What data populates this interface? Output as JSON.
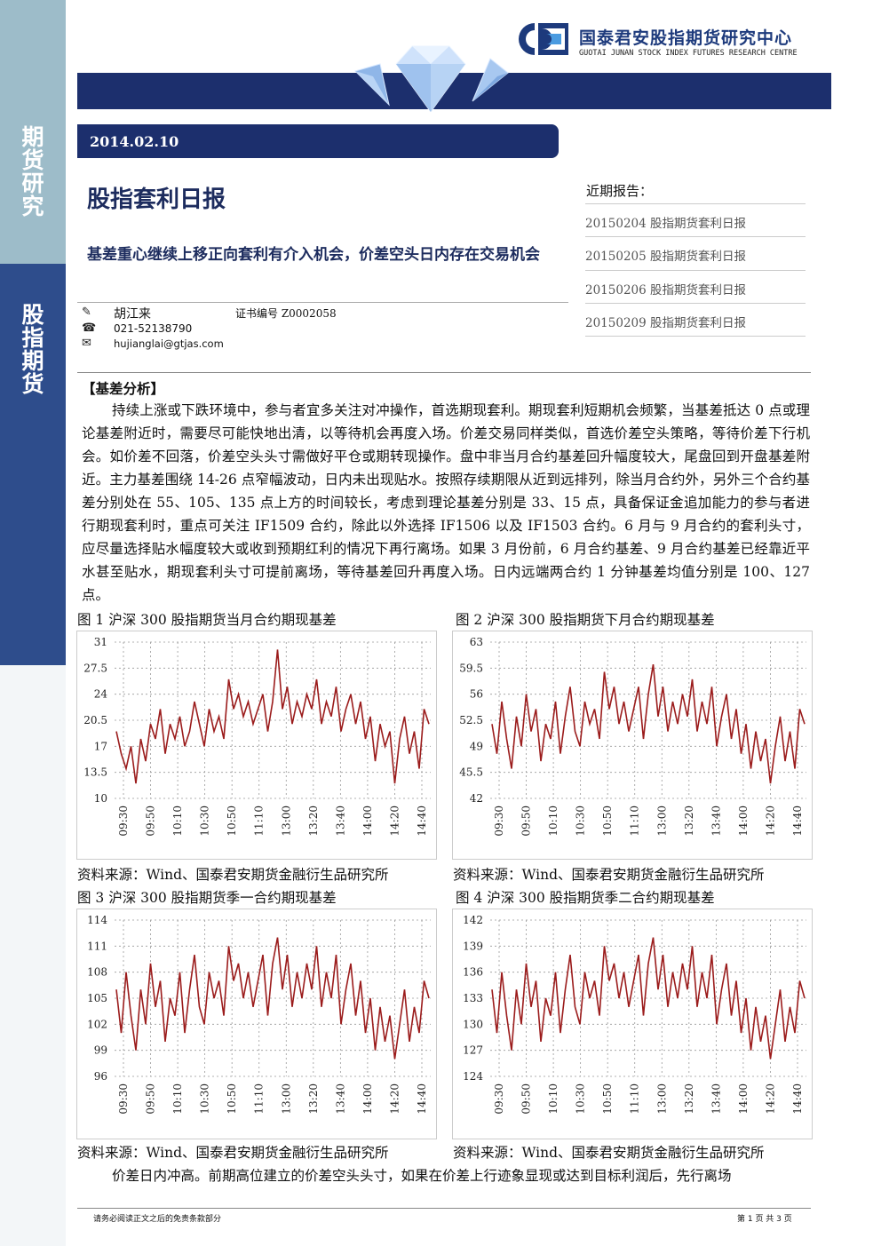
{
  "sidebar": {
    "top_label": "期货研究",
    "mid_label": "股指期货"
  },
  "header": {
    "org_cn": "国泰君安股指期货研究中心",
    "org_en": "GUOTAI JUNAN STOCK INDEX FUTURES RESEARCH CENTRE",
    "date": "2014.02.10",
    "brand_color": "#1c2f6d"
  },
  "report": {
    "title": "股指套利日报",
    "subtitle": "基差重心继续上移正向套利有介入机会，价差空头日内存在交易机会"
  },
  "author": {
    "name": "胡江来",
    "cert": "证书编号 Z0002058",
    "phone": "021-52138790",
    "email": "hujianglai@gtjas.com"
  },
  "recent": {
    "title": "近期报告：",
    "items": [
      "20150204 股指期货套利日报",
      "20150205 股指期货套利日报",
      "20150206 股指期货套利日报",
      "20150209 股指期货套利日报"
    ]
  },
  "section": {
    "label": "【基差分析】",
    "paragraph": "持续上涨或下跌环境中，参与者宜多关注对冲操作，首选期现套利。期现套利短期机会频繁，当基差抵达 0 点或理论基差附近时，需要尽可能快地出清，以等待机会再度入场。价差交易同样类似，首选价差空头策略，等待价差下行机会。如价差不回落，价差空头头寸需做好平仓或期转现操作。盘中非当月合约基差回升幅度较大，尾盘回到开盘基差附近。主力基差围绕 14-26 点窄幅波动，日内未出现贴水。按照存续期限从近到远排列，除当月合约外，另外三个合约基差分别处在 55、105、135 点上方的时间较长，考虑到理论基差分别是 33、15 点，具备保证金追加能力的参与者进行期现套利时，重点可关注 IF1509 合约，除此以外选择 IF1506 以及 IF1503 合约。6 月与 9 月合约的套利头寸，应尽量选择贴水幅度较大或收到预期红利的情况下再行离场。如果 3 月份前，6 月合约基差、9 月合约基差已经靠近平水甚至贴水，期现套利头寸可提前离场，等待基差回升再度入场。日内远端两合约 1 分钟基差均值分别是 100、127 点。",
    "paragraph2": "价差日内冲高。前期高位建立的价差空头头寸，如果在价差上行迹象显现或达到目标利润后，先行离场"
  },
  "figures": [
    {
      "title": "图 1 沪深 300 股指期货当月合约期现基差",
      "source": "资料来源：Wind、国泰君安期货金融衍生品研究所"
    },
    {
      "title": "图 2 沪深 300 股指期货下月合约期现基差",
      "source": "资料来源：Wind、国泰君安期货金融衍生品研究所"
    },
    {
      "title": "图 3 沪深 300 股指期货季一合约期现基差",
      "source": "资料来源：Wind、国泰君安期货金融衍生品研究所"
    },
    {
      "title": "图 4 沪深 300 股指期货季二合约期现基差",
      "source": "资料来源：Wind、国泰君安期货金融衍生品研究所"
    }
  ],
  "chart_data": [
    {
      "type": "line",
      "line_color": "#9b1c1c",
      "grid": true,
      "x_ticks": [
        "09:30",
        "09:50",
        "10:10",
        "10:30",
        "10:50",
        "11:10",
        "13:00",
        "13:20",
        "13:40",
        "14:00",
        "14:20",
        "14:40"
      ],
      "y_ticks": [
        "31",
        "27.5",
        "24",
        "20.5",
        "17",
        "13.5",
        "10"
      ],
      "ylim": [
        10,
        31
      ],
      "series": [
        {
          "values": [
            19,
            16,
            14,
            17,
            12,
            18,
            15,
            20,
            18,
            22,
            16,
            20,
            18,
            21,
            17,
            19,
            23,
            20,
            17,
            22,
            19,
            21,
            18,
            26,
            22,
            24,
            21,
            23,
            20,
            22,
            24,
            19,
            23,
            30,
            22,
            25,
            20,
            23,
            21,
            24,
            22,
            26,
            20,
            23,
            21,
            25,
            19,
            22,
            24,
            20,
            23,
            18,
            21,
            15,
            20,
            17,
            19,
            12,
            18,
            21,
            16,
            19,
            14,
            22,
            20
          ]
        }
      ]
    },
    {
      "type": "line",
      "line_color": "#9b1c1c",
      "grid": true,
      "x_ticks": [
        "09:30",
        "09:50",
        "10:10",
        "10:30",
        "10:50",
        "11:10",
        "13:00",
        "13:20",
        "13:40",
        "14:00",
        "14:20",
        "14:40"
      ],
      "y_ticks": [
        "63",
        "59.5",
        "56",
        "52.5",
        "49",
        "45.5",
        "42"
      ],
      "ylim": [
        42,
        63
      ],
      "series": [
        {
          "values": [
            52,
            48,
            55,
            50,
            46,
            53,
            49,
            56,
            51,
            54,
            47,
            52,
            50,
            55,
            48,
            53,
            57,
            51,
            49,
            55,
            52,
            54,
            50,
            59,
            54,
            57,
            52,
            55,
            51,
            54,
            57,
            50,
            56,
            60,
            53,
            57,
            51,
            55,
            52,
            56,
            53,
            58,
            51,
            55,
            52,
            57,
            49,
            53,
            56,
            50,
            54,
            48,
            52,
            46,
            51,
            47,
            50,
            44,
            49,
            53,
            47,
            51,
            46,
            54,
            52
          ]
        }
      ]
    },
    {
      "type": "line",
      "line_color": "#9b1c1c",
      "grid": true,
      "x_ticks": [
        "09:30",
        "09:50",
        "10:10",
        "10:30",
        "10:50",
        "11:10",
        "13:00",
        "13:20",
        "13:40",
        "14:00",
        "14:20",
        "14:40"
      ],
      "y_ticks": [
        "114",
        "111",
        "108",
        "105",
        "102",
        "99",
        "96"
      ],
      "ylim": [
        96,
        114
      ],
      "series": [
        {
          "values": [
            106,
            101,
            108,
            103,
            99,
            106,
            102,
            109,
            104,
            107,
            100,
            105,
            103,
            108,
            101,
            106,
            110,
            104,
            102,
            108,
            105,
            107,
            103,
            111,
            107,
            109,
            105,
            108,
            104,
            107,
            110,
            103,
            109,
            112,
            106,
            110,
            104,
            108,
            105,
            109,
            106,
            111,
            104,
            108,
            105,
            110,
            102,
            106,
            109,
            103,
            107,
            101,
            105,
            99,
            104,
            100,
            103,
            98,
            102,
            106,
            100,
            104,
            101,
            107,
            105
          ]
        }
      ]
    },
    {
      "type": "line",
      "line_color": "#9b1c1c",
      "grid": true,
      "x_ticks": [
        "09:30",
        "09:50",
        "10:10",
        "10:30",
        "10:50",
        "11:10",
        "13:00",
        "13:20",
        "13:40",
        "14:00",
        "14:20",
        "14:40"
      ],
      "y_ticks": [
        "142",
        "139",
        "136",
        "133",
        "130",
        "127",
        "124"
      ],
      "ylim": [
        124,
        142
      ],
      "series": [
        {
          "values": [
            134,
            129,
            136,
            131,
            127,
            134,
            130,
            137,
            132,
            135,
            128,
            133,
            131,
            136,
            129,
            134,
            138,
            132,
            130,
            136,
            133,
            135,
            131,
            139,
            135,
            137,
            133,
            136,
            132,
            135,
            138,
            131,
            137,
            140,
            134,
            138,
            132,
            136,
            133,
            137,
            134,
            139,
            132,
            136,
            133,
            138,
            130,
            134,
            137,
            131,
            135,
            129,
            133,
            127,
            132,
            128,
            131,
            126,
            130,
            134,
            128,
            132,
            129,
            135,
            133
          ]
        }
      ]
    }
  ],
  "footer": {
    "left": "请务必阅读正文之后的免责条款部分",
    "right": "第 1 页 共 3 页"
  }
}
